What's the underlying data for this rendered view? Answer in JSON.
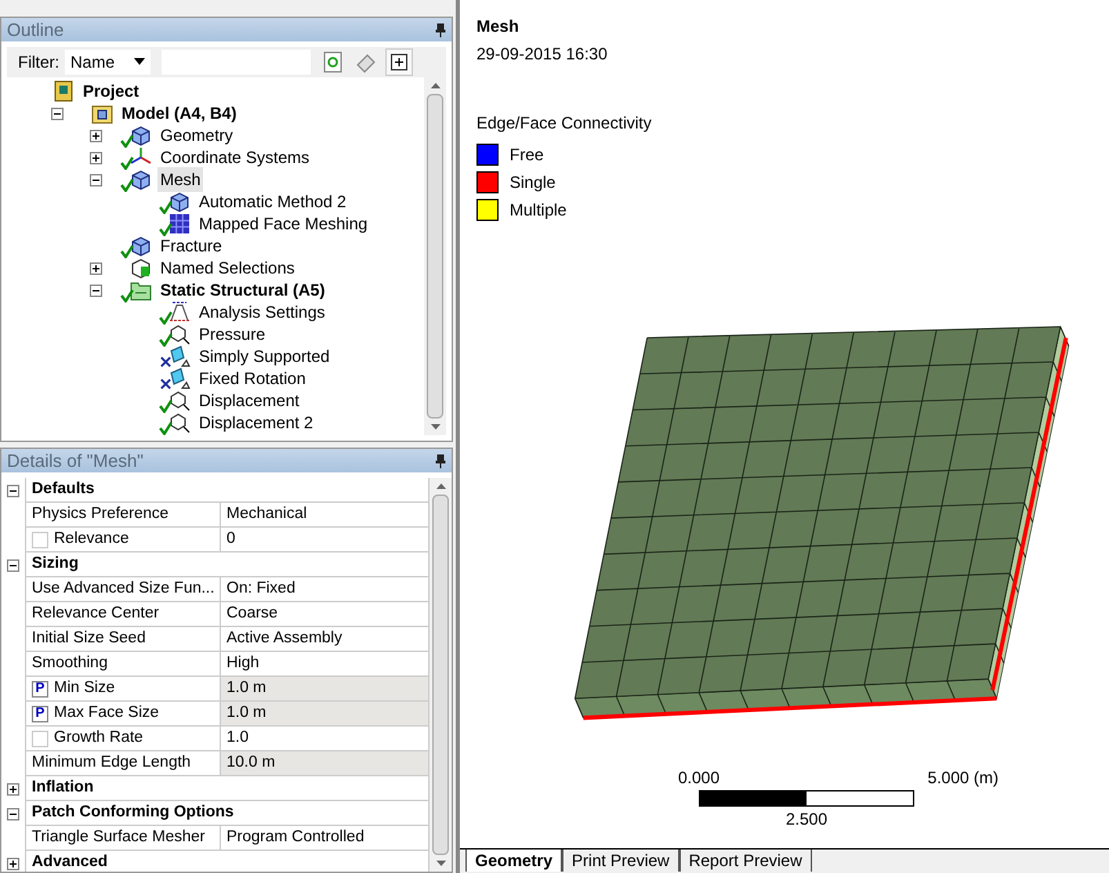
{
  "outline": {
    "title": "Outline",
    "filter_label": "Filter:",
    "filter_value": "Name",
    "tree": [
      {
        "label": "Project",
        "kind": "project",
        "bold": true,
        "children": [
          {
            "label": "Model (A4, B4)",
            "kind": "model",
            "bold": true,
            "expanded": true,
            "children": [
              {
                "label": "Geometry",
                "kind": "geometry",
                "valid": true,
                "expanded": false
              },
              {
                "label": "Coordinate Systems",
                "kind": "axes",
                "valid": true,
                "expanded": false
              },
              {
                "label": "Mesh",
                "kind": "mesh",
                "valid": true,
                "expanded": true,
                "selected": true,
                "children": [
                  {
                    "label": "Automatic Method 2",
                    "kind": "mesh",
                    "valid": true
                  },
                  {
                    "label": "Mapped Face Meshing",
                    "kind": "grid",
                    "valid": true
                  }
                ]
              },
              {
                "label": "Fracture",
                "kind": "mesh",
                "valid": true
              },
              {
                "label": "Named Selections",
                "kind": "named",
                "expanded": false
              },
              {
                "label": "Static Structural (A5)",
                "kind": "folder",
                "bold": true,
                "valid": true,
                "expanded": true,
                "children": [
                  {
                    "label": "Analysis Settings",
                    "kind": "settings",
                    "valid": true
                  },
                  {
                    "label": "Pressure",
                    "kind": "load",
                    "valid": true
                  },
                  {
                    "label": "Simply Supported",
                    "kind": "support",
                    "valid": false
                  },
                  {
                    "label": "Fixed Rotation",
                    "kind": "support",
                    "valid": false
                  },
                  {
                    "label": "Displacement",
                    "kind": "load",
                    "valid": true
                  },
                  {
                    "label": "Displacement 2",
                    "kind": "load",
                    "valid": true
                  }
                ]
              }
            ]
          }
        ]
      }
    ]
  },
  "details": {
    "title": "Details of \"Mesh\"",
    "rows": [
      {
        "kind": "group",
        "label": "Defaults",
        "expanded": true
      },
      {
        "kind": "row",
        "label": "Physics Preference",
        "value": "Mechanical"
      },
      {
        "kind": "row",
        "label": "Relevance",
        "value": "0",
        "checked": false
      },
      {
        "kind": "group",
        "label": "Sizing",
        "expanded": true
      },
      {
        "kind": "row",
        "label": "Use Advanced Size Fun...",
        "value": "On: Fixed"
      },
      {
        "kind": "row",
        "label": "Relevance Center",
        "value": "Coarse"
      },
      {
        "kind": "row",
        "label": "Initial Size Seed",
        "value": "Active Assembly"
      },
      {
        "kind": "row",
        "label": "Smoothing",
        "value": "High"
      },
      {
        "kind": "row",
        "label": "Min Size",
        "value": "1.0 m",
        "parameter": "P",
        "shaded": true
      },
      {
        "kind": "row",
        "label": "Max Face Size",
        "value": "1.0 m",
        "parameter": "P",
        "shaded": true
      },
      {
        "kind": "row",
        "label": "Growth Rate",
        "value": "1.0",
        "checked": false
      },
      {
        "kind": "row",
        "label": "Minimum Edge Length",
        "value": "10.0 m",
        "shaded": true
      },
      {
        "kind": "group",
        "label": "Inflation",
        "expanded": false
      },
      {
        "kind": "group",
        "label": "Patch Conforming Options",
        "expanded": true
      },
      {
        "kind": "row",
        "label": "Triangle Surface Mesher",
        "value": "Program Controlled"
      },
      {
        "kind": "group",
        "label": "Advanced",
        "expanded": false
      }
    ]
  },
  "viewport": {
    "title": "Mesh",
    "timestamp": "29-09-2015 16:30",
    "legend_title": "Edge/Face Connectivity",
    "legend": [
      {
        "label": "Free",
        "color": "#0000ff"
      },
      {
        "label": "Single",
        "color": "#ff0000"
      },
      {
        "label": "Multiple",
        "color": "#ffff00"
      }
    ],
    "scale": {
      "start": "0.000",
      "end": "5.000 (m)",
      "middle": "2.500"
    },
    "tabs": [
      {
        "label": "Geometry",
        "selected": true
      },
      {
        "label": "Print Preview",
        "selected": false
      },
      {
        "label": "Report Preview",
        "selected": false
      }
    ]
  }
}
